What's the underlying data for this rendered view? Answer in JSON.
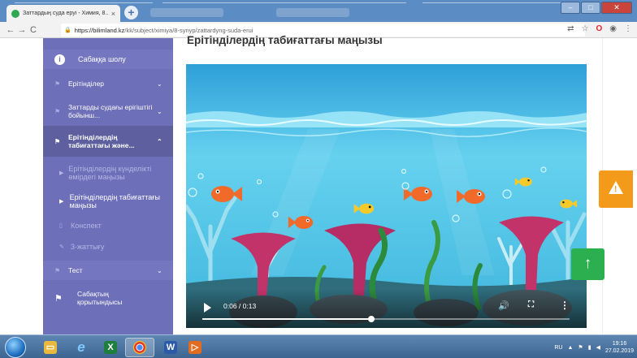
{
  "browser": {
    "tab_title": "Заттардың суда еруі - Химия, 8...",
    "tab_close": "×",
    "new_tab": "+",
    "url_host": "https://bilimland.kz",
    "url_path": "/kk/subject/ximiya/8-synyp/zattardyng-suda-erui",
    "back": "←",
    "forward": "→",
    "reload": "C",
    "lock": "🔒",
    "window_minimize": "–",
    "window_maximize": "□",
    "window_close": "✕",
    "toolbar_icons": [
      "translate-icon",
      "star-icon",
      "opera-icon",
      "account-icon",
      "menu-icon"
    ]
  },
  "sidebar": {
    "overview": "Сабаққа шолу",
    "sections": [
      {
        "label": "Ерітінділер",
        "chev": "⌄"
      },
      {
        "label": "Заттарды судағы ерігіштігі бойынш...",
        "chev": "⌄"
      },
      {
        "label": "Ерітінділердің табиғаттағы және...",
        "chev": "⌃"
      }
    ],
    "subitems": [
      {
        "label": "Ерітінділердің күнделікті өмірдегі маңызы",
        "arrow": "▶"
      },
      {
        "label": "Ерітінділердің табиғаттағы маңызы",
        "arrow": "▶"
      },
      {
        "label": "Конспект",
        "arrow": "▯"
      },
      {
        "label": "3-жаттығу",
        "arrow": "✎"
      }
    ],
    "test": "Тест",
    "test_chev": "⌄",
    "final": "Сабақтың қорытындысы"
  },
  "main": {
    "heading": "Ерітінділердің табиғаттағы маңызы"
  },
  "video": {
    "time": "0:06 / 0:13",
    "progress": 0.46,
    "volume_icon": "🔊",
    "fullscreen_icon": "⛶",
    "more_icon": "⋮"
  },
  "buttons": {
    "warning_icon": "!",
    "up_icon": "↑"
  },
  "taskbar": {
    "apps": [
      "explorer-icon",
      "ie-icon",
      "excel-icon",
      "chrome-icon",
      "word-icon",
      "media-icon"
    ],
    "lang": "RU",
    "time": "19:16",
    "date": "27.02.2019"
  },
  "colors": {
    "sidebar": "#6d6fb8",
    "sidebar_active": "#5d5f9e",
    "warning": "#f39a1a",
    "up": "#2cb04f",
    "water": "#58c7e8"
  }
}
